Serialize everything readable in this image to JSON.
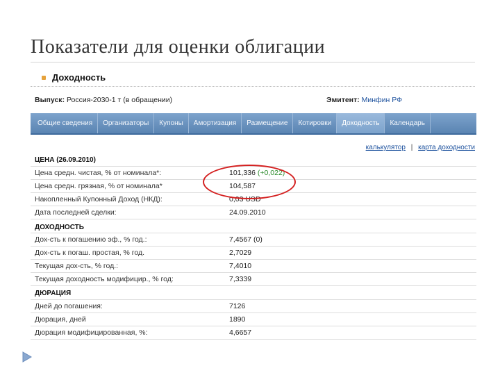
{
  "slide": {
    "title": "Показатели для оценки облигации",
    "bullet": "Доходность"
  },
  "bond": {
    "issue_label": "Выпуск:",
    "issue_value": "Россия-2030-1 т (в обращении)",
    "issuer_label": "Эмитент:",
    "issuer_value": "Минфин РФ"
  },
  "tabs": [
    {
      "label": "Общие сведения",
      "active": false
    },
    {
      "label": "Организаторы",
      "active": false
    },
    {
      "label": "Купоны",
      "active": false
    },
    {
      "label": "Амортизация",
      "active": false
    },
    {
      "label": "Размещение",
      "active": false
    },
    {
      "label": "Котировки",
      "active": false
    },
    {
      "label": "Доходность",
      "active": true
    },
    {
      "label": "Календарь",
      "active": false
    }
  ],
  "links": {
    "calculator": "калькулятор",
    "separator": "|",
    "yield_map": "карта доходности"
  },
  "sections": {
    "price": {
      "header": "ЦЕНА (26.09.2010)",
      "rows": [
        {
          "label": "Цена средн. чистая, % от номинала*:",
          "value": "101,336",
          "change": "(+0,022)"
        },
        {
          "label": "Цена средн. грязная, % от номинала*",
          "value": "104,587"
        },
        {
          "label": "Накопленный Купонный Доход (НКД):",
          "value": "0,03 USD"
        },
        {
          "label": "Дата последней сделки:",
          "value": "24.09.2010"
        }
      ]
    },
    "yield": {
      "header": "ДОХОДНОСТЬ",
      "rows": [
        {
          "label": "Дох-сть к погашению эф., % год.:",
          "value": "7,4567",
          "change": "(0)"
        },
        {
          "label": "Дох-сть к погаш. простая, % год.",
          "value": "2,7029"
        },
        {
          "label": "Текущая дох-сть, % год.:",
          "value": "7,4010"
        },
        {
          "label": "Текущая доходность модифицир., % год:",
          "value": "7,3339"
        }
      ]
    },
    "duration": {
      "header": "ДЮРАЦИЯ",
      "rows": [
        {
          "label": "Дней до погашения:",
          "value": "7126"
        },
        {
          "label": "Дюрация, дней",
          "value": "1890"
        },
        {
          "label": "Дюрация модифицированная, %:",
          "value": "4,6657"
        }
      ]
    }
  },
  "colors": {
    "tab_bar": "#6b93c0",
    "highlight": "#d42020",
    "change_positive": "#2a8a2a",
    "link": "#1a4f9c"
  }
}
